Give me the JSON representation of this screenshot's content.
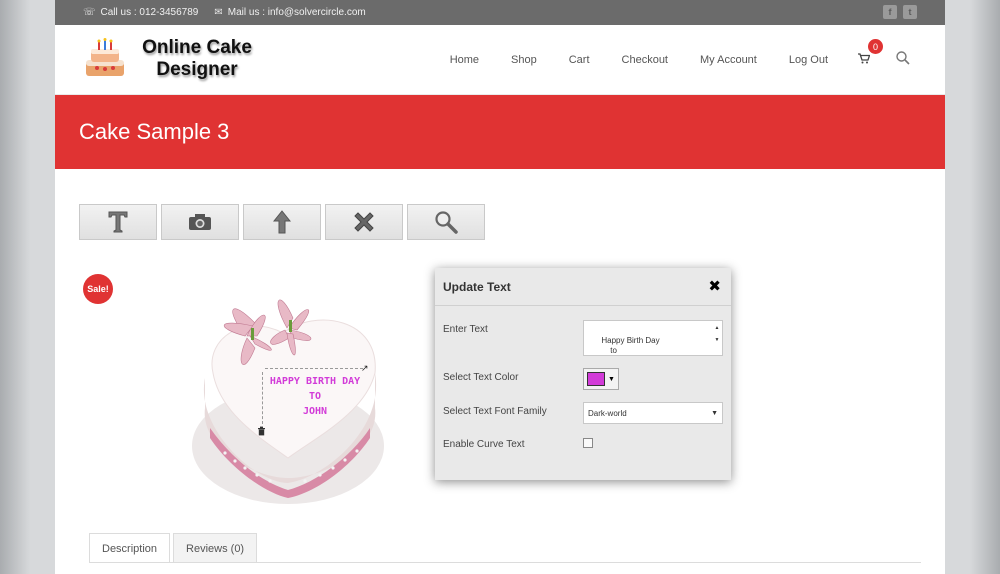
{
  "topbar": {
    "call": "Call us : 012-3456789",
    "mail": "Mail us : info@solvercircle.com",
    "social": [
      "facebook-icon",
      "twitter-icon"
    ]
  },
  "header": {
    "logo_line1": "Online Cake",
    "logo_line2": "Designer",
    "nav": [
      "Home",
      "Shop",
      "Cart",
      "Checkout",
      "My Account",
      "Log Out"
    ],
    "cart_count": "0"
  },
  "page_title": "Cake Sample 3",
  "toolbar": {
    "tools": [
      "text-tool-icon",
      "camera-icon",
      "upload-arrow-icon",
      "delete-x-icon",
      "zoom-icon"
    ]
  },
  "product": {
    "sale_badge": "Sale!",
    "cake_text_lines": [
      "HAPPY BIRTH DAY",
      "TO",
      "JOHN"
    ]
  },
  "panel": {
    "title": "Update Text",
    "enter_text_label": "Enter Text",
    "enter_text_value": "Happy Birth Day\n          to\n        John",
    "color_label": "Select Text Color",
    "color_value": "#d23bd8",
    "font_label": "Select Text Font Family",
    "font_value": "Dark-world",
    "curve_label": "Enable Curve Text"
  },
  "tabs": [
    "Description",
    "Reviews (0)"
  ],
  "colors": {
    "accent": "#e03333",
    "topbar": "#6b6b6b"
  }
}
